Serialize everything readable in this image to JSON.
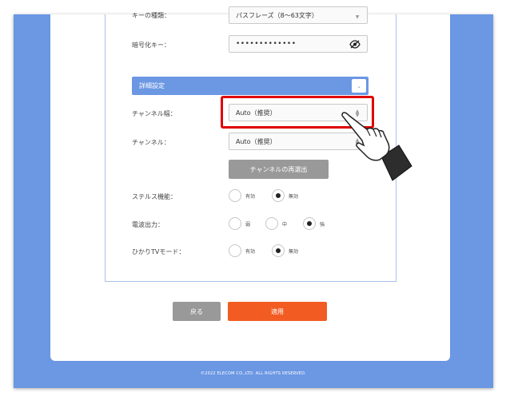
{
  "form": {
    "key_type_label": "キーの種類：",
    "key_type_value": "パスフレーズ（8〜63文字）",
    "encryption_key_label": "暗号化キー：",
    "encryption_key_value": "•••••••••••••",
    "advanced_section_title": "詳細設定",
    "advanced_toggle_icon": "⌄",
    "channel_width_label": "チャンネル幅：",
    "channel_width_value": "Auto（推奨）",
    "channel_label": "チャンネル：",
    "channel_value": "Auto（推奨）",
    "rescan_button": "チャンネルの再選出",
    "stealth_label": "ステルス機能：",
    "stealth_options": [
      "有効",
      "無効"
    ],
    "stealth_selected": "無効",
    "power_label": "電波出力：",
    "power_options": [
      "弱",
      "中",
      "強"
    ],
    "power_selected": "強",
    "hikari_label": "ひかりTVモード：",
    "hikari_options": [
      "有効",
      "無効"
    ],
    "hikari_selected": "無効"
  },
  "actions": {
    "back_label": "戻る",
    "apply_label": "適用"
  },
  "footer": {
    "copyright": "©2022 ELECOM CO.,LTD. ALL RIGHTS RESERVED."
  },
  "colors": {
    "frame_blue": "#6b97e3",
    "apply_orange": "#f25c22",
    "back_gray": "#999999",
    "highlight_red": "#e00000"
  },
  "icons": {
    "password_visibility": "eye-slash-icon",
    "dropdown": "updown-arrows-icon",
    "pointer": "pointing-hand-icon"
  }
}
